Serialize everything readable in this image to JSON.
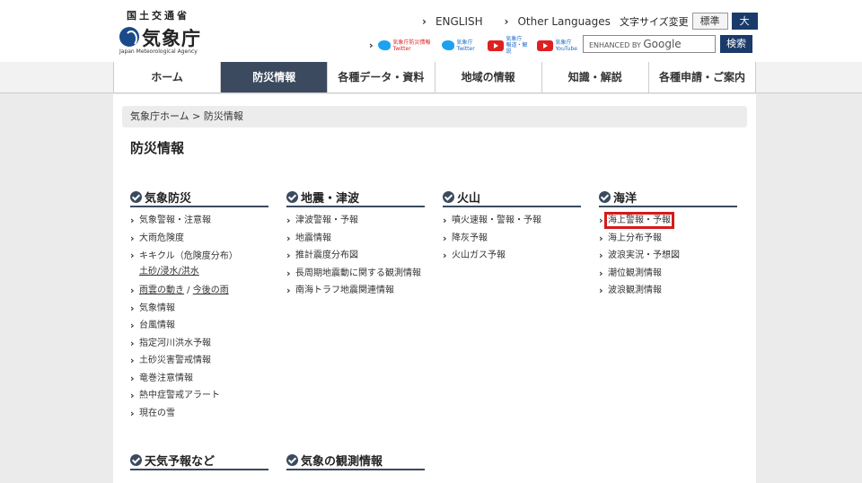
{
  "header": {
    "ministry": "国土交通省",
    "agency_name": "気象庁",
    "agency_name_en": "Japan Meteorological Agency",
    "english_link": "ENGLISH",
    "other_languages_link": "Other Languages",
    "font_size_label": "文字サイズ変更",
    "font_standard": "標準",
    "font_large": "大",
    "social": {
      "twitter_bousai": "気象庁防災情報 Twitter",
      "twitter": "気象庁 Twitter",
      "youtube_news": "気象庁 報道・解説",
      "youtube": "気象庁 YouTube"
    },
    "search_enhanced": "ENHANCED BY",
    "search_brand": "Google",
    "search_button": "検索"
  },
  "nav": [
    "ホーム",
    "防災情報",
    "各種データ・資料",
    "地域の情報",
    "知識・解説",
    "各種申請・ご案内"
  ],
  "breadcrumb": "気象庁ホーム > 防災情報",
  "page_title": "防災情報",
  "sections": {
    "kisho": {
      "title": "気象防災",
      "items": [
        "気象警報・注意報",
        "大雨危険度",
        "キキクル（危険度分布）",
        "土砂",
        "/浸水",
        "/洪水",
        "雨雲の動き",
        " / ",
        "今後の雨",
        "気象情報",
        "台風情報",
        "指定河川洪水予報",
        "土砂災害警戒情報",
        "竜巻注意情報",
        "熱中症警戒アラート",
        "現在の雪"
      ]
    },
    "jishin": {
      "title": "地震・津波",
      "items": [
        "津波警報・予報",
        "地震情報",
        "推計震度分布図",
        "長周期地震動に関する観測情報",
        "南海トラフ地震関連情報"
      ]
    },
    "kazan": {
      "title": "火山",
      "items": [
        "噴火速報・警報・予報",
        "降灰予報",
        "火山ガス予報"
      ]
    },
    "kaiyo": {
      "title": "海洋",
      "items": [
        "海上警報・予報",
        "海上分布予報",
        "波浪実況・予想図",
        "潮位観測情報",
        "波浪観測情報"
      ]
    },
    "tenki": {
      "title": "天気予報など"
    },
    "kansoku": {
      "title": "気象の観測情報"
    }
  }
}
